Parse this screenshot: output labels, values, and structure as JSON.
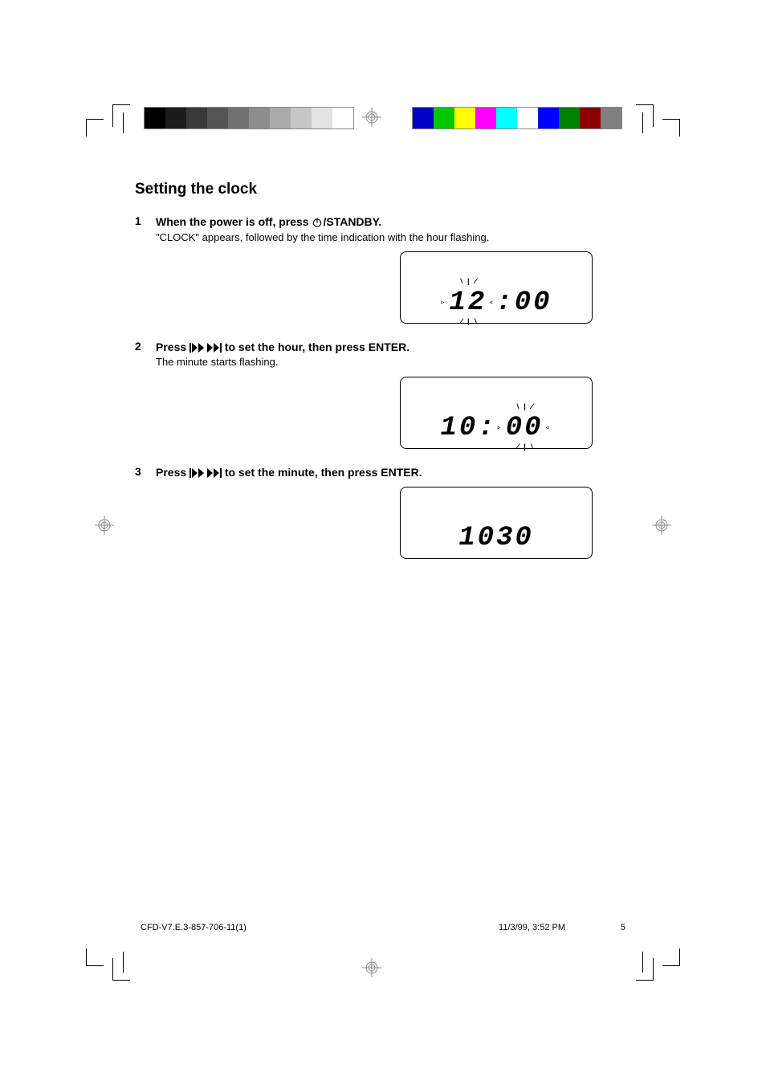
{
  "section_title": "Setting the clock",
  "steps": [
    {
      "num": "1",
      "main_pre": "When the power is off, press ",
      "main_post": "/STANDBY.",
      "sub": "\"CLOCK\" appears, followed by the time indication with the hour flashing."
    },
    {
      "num": "2",
      "main_pre": "Press ",
      "main_post": " to set the hour, then press ENTER.",
      "sub": "The minute starts flashing."
    },
    {
      "num": "3",
      "main_pre": "Press ",
      "main_post": " to set the minute, then press ENTER."
    }
  ],
  "lcd": {
    "d1": {
      "hours": "12",
      "sep": ":",
      "minutes": "00"
    },
    "d2": {
      "hours": "10",
      "sep": ":",
      "minutes": "00"
    },
    "d3": {
      "hours": "10",
      "gap": " ",
      "minutes": "30"
    }
  },
  "footer": {
    "filename": "CFD-V7.E.3-857-706-11(1)",
    "pagenum": "5",
    "date": "11/3/99, 3:52 PM"
  }
}
